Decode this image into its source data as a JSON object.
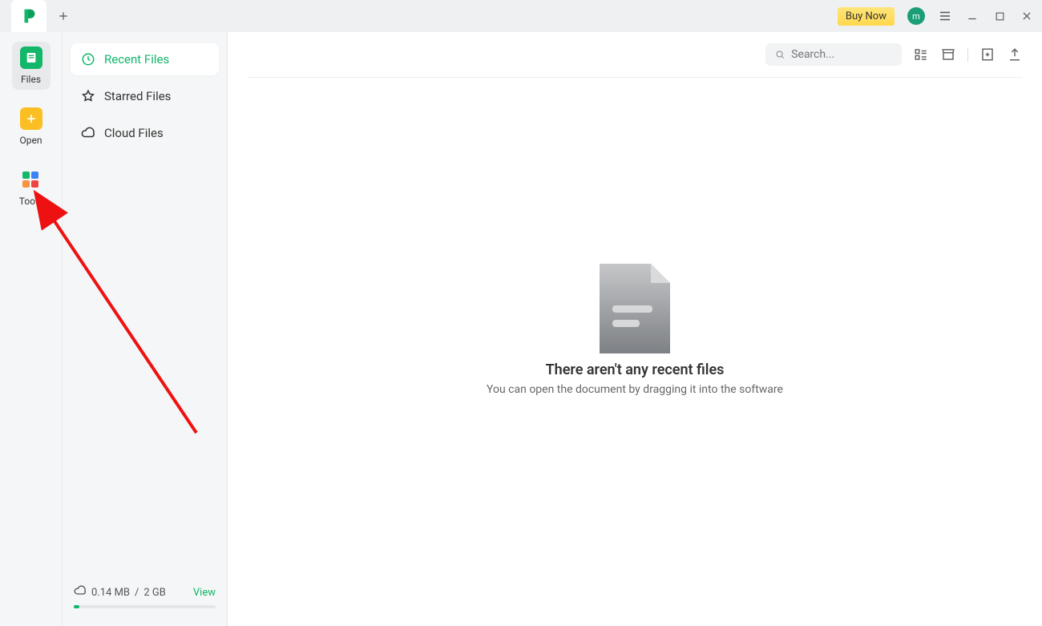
{
  "titlebar": {
    "buy_now": "Buy Now",
    "avatar_initial": "m"
  },
  "rail": {
    "files": "Files",
    "open": "Open",
    "tools": "Tools"
  },
  "sidebar": {
    "recent": "Recent Files",
    "starred": "Starred Files",
    "cloud": "Cloud Files"
  },
  "storage": {
    "used": "0.14 MB",
    "sep": "/",
    "total": "2 GB",
    "view": "View"
  },
  "search": {
    "placeholder": "Search..."
  },
  "empty": {
    "title": "There aren't any recent files",
    "subtitle": "You can open the document by dragging it into the software"
  }
}
